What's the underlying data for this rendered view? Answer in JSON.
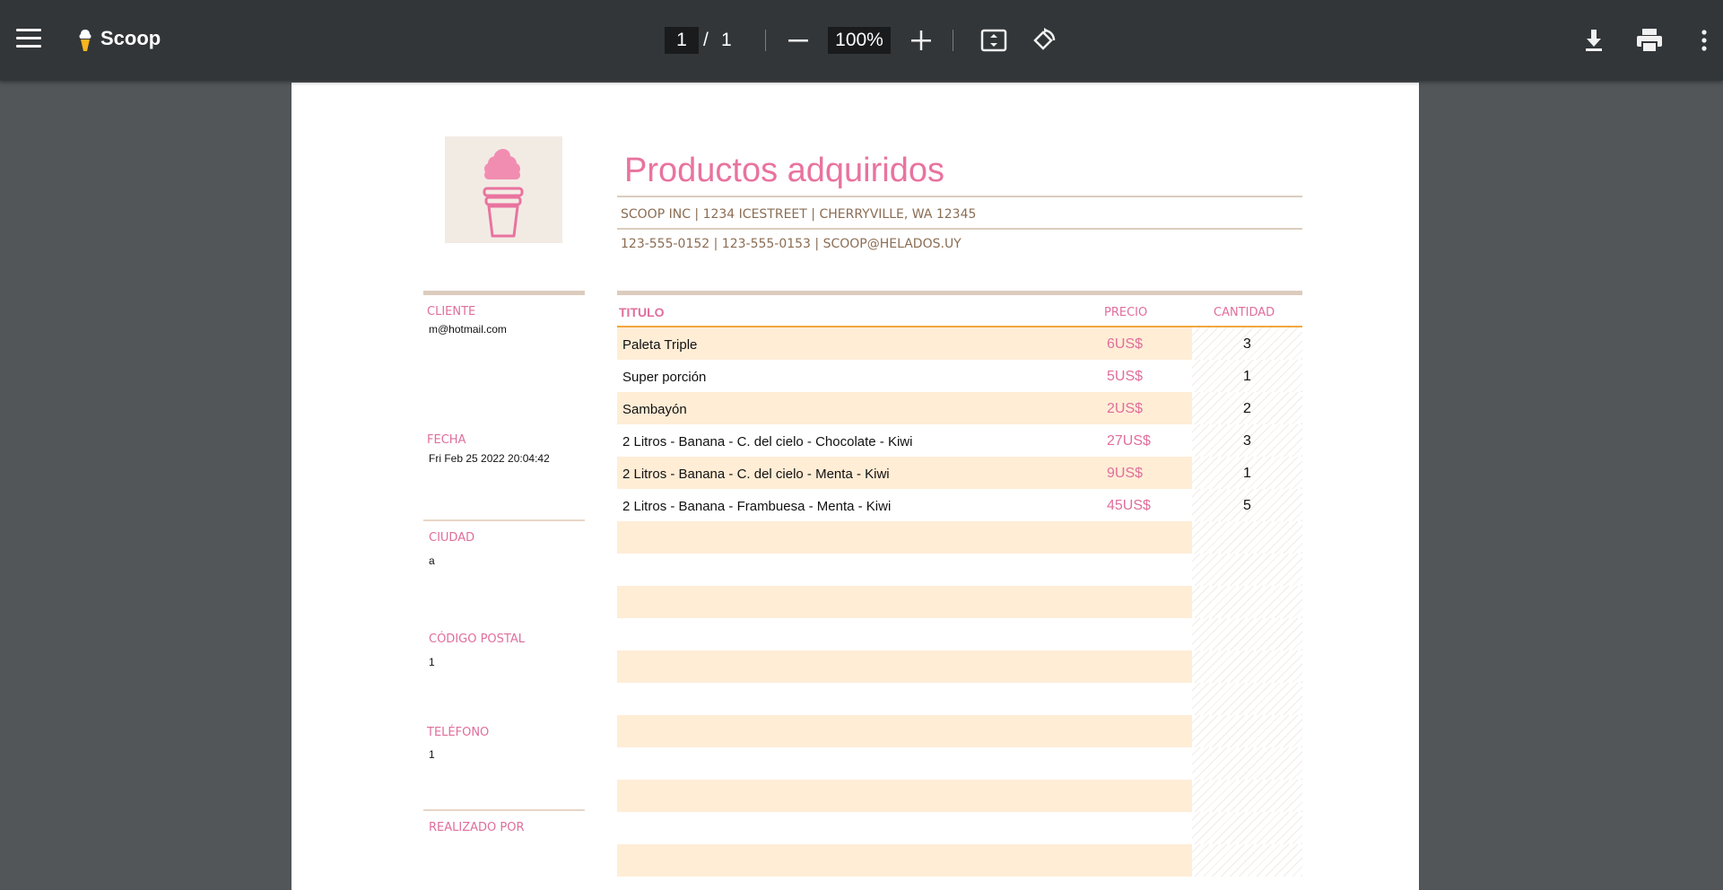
{
  "viewer": {
    "app_title": "Scoop",
    "current_page": "1",
    "page_separator": "/",
    "total_pages": "1",
    "zoom": "100%"
  },
  "document": {
    "title": "Productos adquiridos",
    "company_line1": "SCOOP INC | 1234 ICESTREET | CHERRYVILLE, WA 12345",
    "company_line2": "123-555-0152  |  123-555-0153  |  SCOOP@HELADOS.UY",
    "sidebar": {
      "cliente_label": "CLIENTE",
      "cliente_value": "m@hotmail.com",
      "fecha_label": "FECHA",
      "fecha_value": "Fri Feb 25 2022 20:04:42",
      "ciudad_label": "CIUDAD",
      "ciudad_value": "a",
      "codigo_label": "CÓDIGO POSTAL",
      "codigo_value": "1",
      "telefono_label": "TELÉFONO",
      "telefono_value": "1",
      "realizado_label": "REALIZADO POR"
    },
    "table": {
      "headers": {
        "titulo": "TITULO",
        "precio": "PRECIO",
        "cantidad": "CANTIDAD"
      },
      "rows": [
        {
          "titulo": "Paleta Triple",
          "precio": "6US$",
          "cantidad": "3"
        },
        {
          "titulo": "Super porción",
          "precio": "5US$",
          "cantidad": "1"
        },
        {
          "titulo": "Sambayón",
          "precio": "2US$",
          "cantidad": "2"
        },
        {
          "titulo": "2 Litros - Banana - C. del cielo - Chocolate - Kiwi",
          "precio": "27US$",
          "cantidad": "3"
        },
        {
          "titulo": "2 Litros - Banana - C. del cielo - Menta - Kiwi",
          "precio": "9US$",
          "cantidad": "1"
        },
        {
          "titulo": "2 Litros - Banana - Frambuesa - Menta - Kiwi",
          "precio": "45US$",
          "cantidad": "5"
        }
      ]
    }
  },
  "colors": {
    "accent_pink": "#e9739f",
    "row_highlight": "#ffedd6",
    "header_rule": "#f2a73f",
    "toolbar": "#323639"
  },
  "icons": [
    "menu-icon",
    "ice-cream-icon",
    "minus-icon",
    "plus-icon",
    "fit-page-icon",
    "rotate-icon",
    "download-icon",
    "print-icon",
    "more-vert-icon",
    "ice-cream-logo-icon"
  ]
}
